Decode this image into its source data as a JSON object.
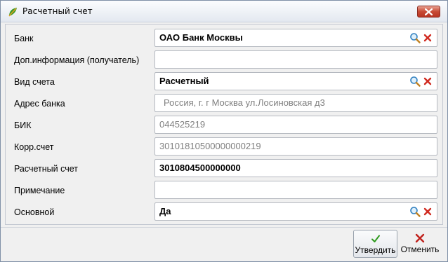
{
  "window": {
    "title": "Расчетный счет",
    "icon": "app-leaf-icon"
  },
  "fields": [
    {
      "key": "bank",
      "label": "Банк",
      "value": "ОАО Банк Москвы",
      "style": "bold",
      "lookup": true
    },
    {
      "key": "extra_info",
      "label": "Доп.информация (получатель)",
      "value": "",
      "style": "normal",
      "lookup": false
    },
    {
      "key": "account_type",
      "label": "Вид счета",
      "value": "Расчетный",
      "style": "bold",
      "lookup": true
    },
    {
      "key": "bank_address",
      "label": "Адрес банка",
      "value": "Россия,  г. г Москва ул.Лосиновская д3",
      "style": "gray",
      "lookup": false
    },
    {
      "key": "bik",
      "label": "БИК",
      "value": "044525219",
      "style": "gray",
      "lookup": false
    },
    {
      "key": "corr_account",
      "label": "Корр.счет",
      "value": "30101810500000000219",
      "style": "gray",
      "lookup": false
    },
    {
      "key": "account",
      "label": "Расчетный счет",
      "value": "3010804500000000",
      "style": "bold",
      "lookup": false
    },
    {
      "key": "note",
      "label": "Примечание",
      "value": "",
      "style": "normal",
      "lookup": false
    },
    {
      "key": "primary",
      "label": "Основной",
      "value": "Да",
      "style": "bold",
      "lookup": true
    }
  ],
  "buttons": {
    "confirm_label": "Утвердить",
    "cancel_label": "Отменить"
  },
  "colors": {
    "confirm_check": "#2e9a1e",
    "cancel_x": "#c0201a",
    "close_button": "#c84a35"
  }
}
